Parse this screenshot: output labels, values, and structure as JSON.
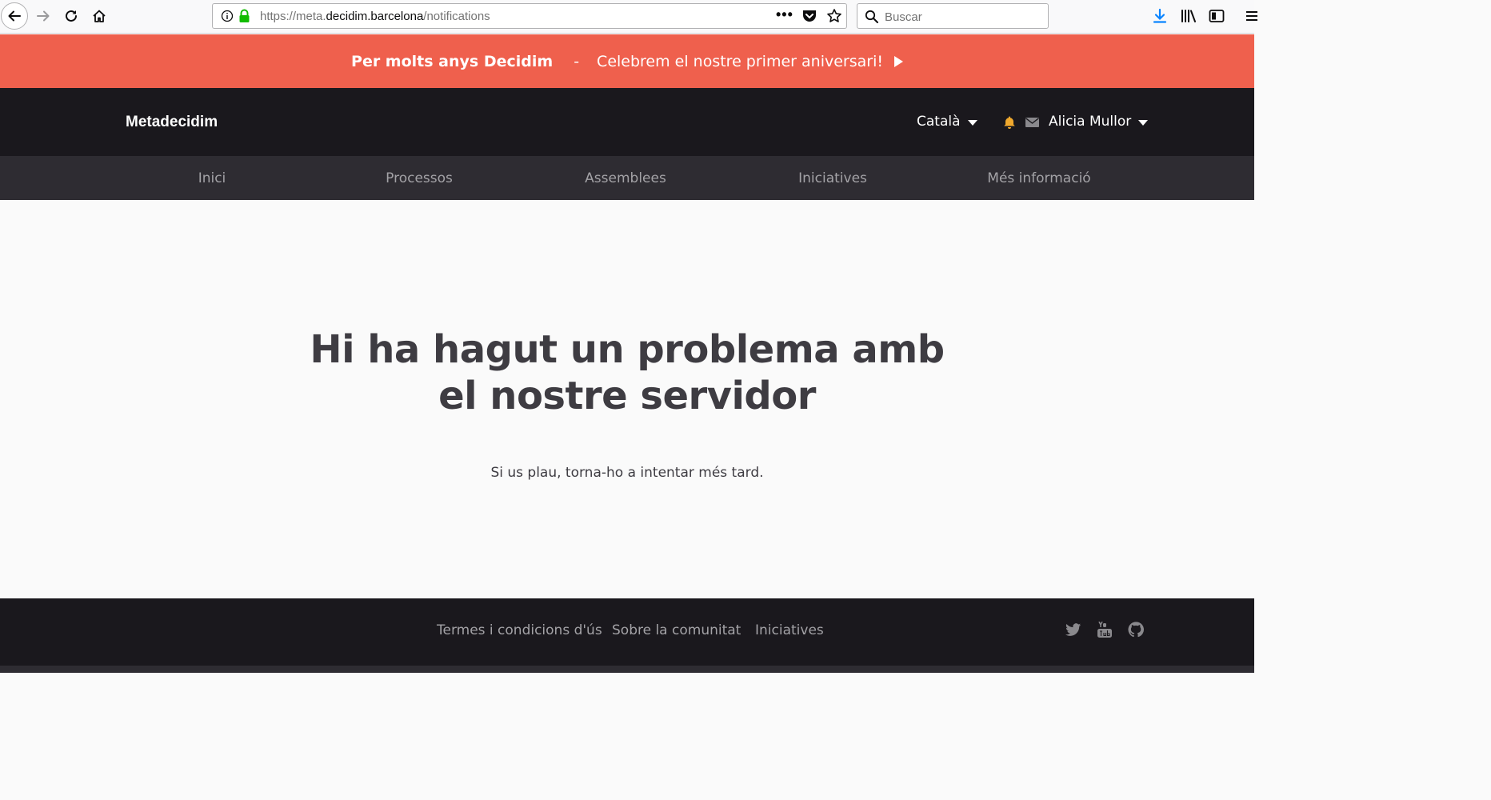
{
  "browser": {
    "url_prefix": "https://meta.",
    "url_domain": "decidim.barcelona",
    "url_path": "/notifications",
    "search_placeholder": "Buscar"
  },
  "announcement": {
    "title": "Per molts anys Decidim",
    "separator": "-",
    "link_text": "Celebrem el nostre primer aniversari!"
  },
  "header": {
    "logo": "Metadecidim",
    "language": "Català",
    "user_name": "Alicia Mullor",
    "bell_color": "#f0a92e"
  },
  "nav": {
    "items": [
      {
        "label": "Inici"
      },
      {
        "label": "Processos"
      },
      {
        "label": "Assemblees"
      },
      {
        "label": "Iniciatives"
      },
      {
        "label": "Més informació"
      }
    ]
  },
  "error": {
    "title": "Hi ha hagut un problema amb el nostre servidor",
    "subtitle": "Si us plau, torna-ho a intentar més tard."
  },
  "footer": {
    "links": [
      {
        "label": "Termes i condicions d'ús"
      },
      {
        "label": "Sobre la comunitat"
      },
      {
        "label": "Iniciatives"
      }
    ],
    "social": [
      "twitter-icon",
      "youtube-icon",
      "github-icon"
    ]
  },
  "colors": {
    "announcement_bg": "#ef604d",
    "header_bg": "#1a181d",
    "nav_bg": "#2e2c32",
    "text_dark": "#3e3c42"
  }
}
